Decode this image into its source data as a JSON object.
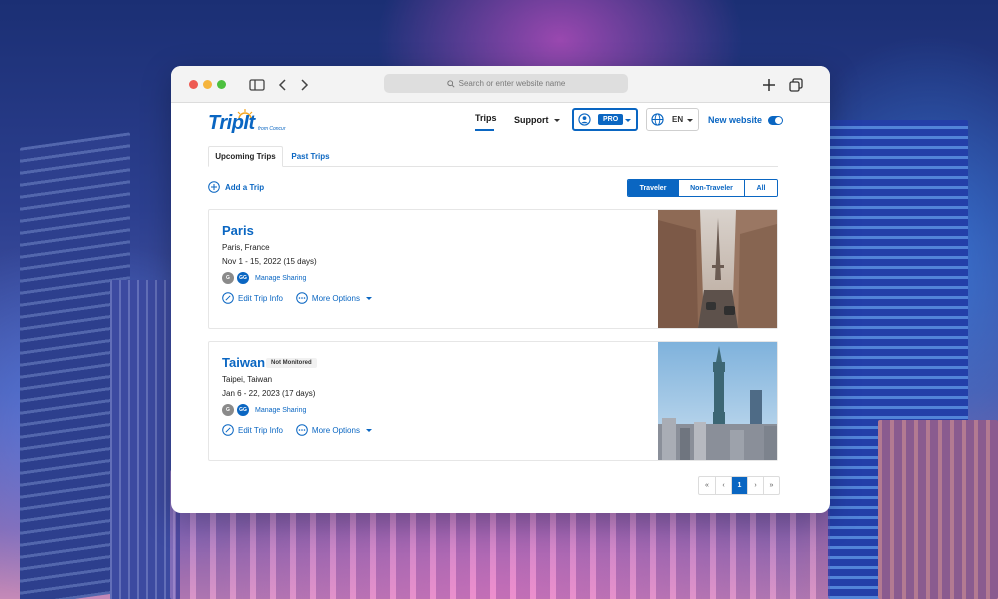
{
  "browser": {
    "address_placeholder": "Search or enter website name"
  },
  "brand": {
    "logo_text": "TripIt",
    "logo_sub": "from Concur",
    "color": "#0a66c2"
  },
  "nav": {
    "trips": "Trips",
    "support": "Support",
    "pro_badge": "PRO",
    "language": "EN",
    "new_website": "New website"
  },
  "tabs": {
    "upcoming": "Upcoming Trips",
    "past": "Past Trips"
  },
  "add_trip": "Add a Trip",
  "filters": [
    "Traveler",
    "Non-Traveler",
    "All"
  ],
  "trips": [
    {
      "title": "Paris",
      "badge": "",
      "location": "Paris, France",
      "dates": "Nov 1 - 15, 2022 (15 days)",
      "avatar_initials": [
        "G",
        "GG"
      ],
      "manage_sharing": "Manage Sharing",
      "edit": "Edit Trip Info",
      "more": "More Options"
    },
    {
      "title": "Taiwan",
      "badge": "Not Monitored",
      "location": "Taipei, Taiwan",
      "dates": "Jan 6 - 22, 2023 (17 days)",
      "avatar_initials": [
        "G",
        "GG"
      ],
      "manage_sharing": "Manage Sharing",
      "edit": "Edit Trip Info",
      "more": "More Options"
    }
  ],
  "pagination": {
    "first": "«",
    "prev": "‹",
    "current": "1",
    "next": "›",
    "last": "»"
  }
}
